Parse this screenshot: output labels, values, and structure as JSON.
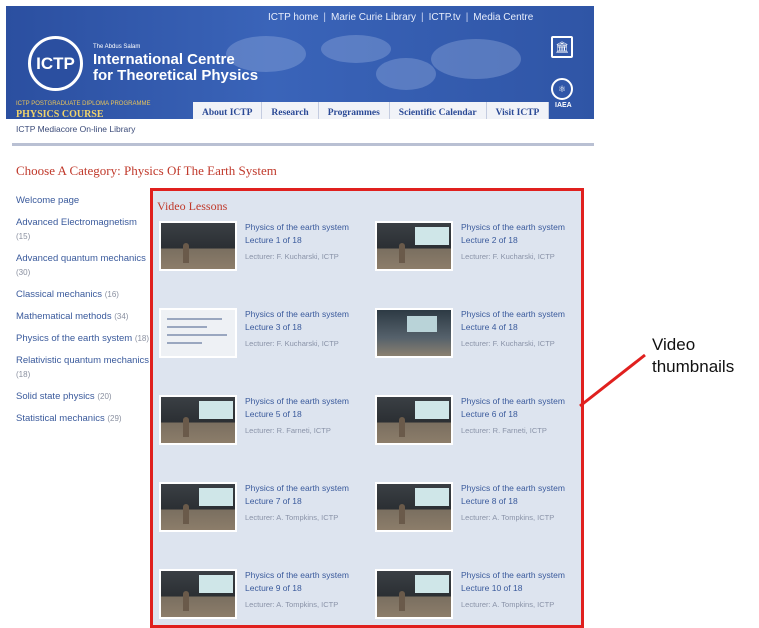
{
  "header": {
    "top_links": [
      "ICTP home",
      "Marie Curie Library",
      "ICTP.tv",
      "Media Centre"
    ],
    "logo_text": "ICTP",
    "org_small": "The Abdus Salam",
    "org_name_line1": "International Centre",
    "org_name_line2": "for Theoretical Physics",
    "course_small": "ICTP POSTGRADUATE DIPLOMA PROGRAMME",
    "course_name": "PHYSICS COURSE",
    "unesco_icon": "unesco-icon",
    "iaea_label": "IAEA"
  },
  "nav": {
    "items": [
      "About ICTP",
      "Research",
      "Programmes",
      "Scientific Calendar",
      "Visit ICTP"
    ]
  },
  "breadcrumb": "ICTP Mediacore On-line Library",
  "category_title": "Choose A Category: Physics Of The Earth System",
  "sidebar": {
    "items": [
      {
        "label": "Welcome page",
        "count": ""
      },
      {
        "label": "Advanced Electromagnetism",
        "count": "(15)"
      },
      {
        "label": "Advanced quantum mechanics",
        "count": "(30)"
      },
      {
        "label": "Classical mechanics",
        "count": "(16)"
      },
      {
        "label": "Mathematical methods",
        "count": "(34)"
      },
      {
        "label": "Physics of the earth system",
        "count": "(18)"
      },
      {
        "label": "Relativistic quantum mechanics",
        "count": "(18)"
      },
      {
        "label": "Solid state physics",
        "count": "(20)"
      },
      {
        "label": "Statistical mechanics",
        "count": "(29)"
      }
    ]
  },
  "videos": {
    "section_title": "Video Lessons",
    "items": [
      {
        "title": "Physics of the earth system",
        "lecture": "Lecture 1 of 18",
        "lecturer": "Lecturer: F. Kucharski, ICTP"
      },
      {
        "title": "Physics of the earth system",
        "lecture": "Lecture 2 of 18",
        "lecturer": "Lecturer: F. Kucharski, ICTP"
      },
      {
        "title": "Physics of the earth system",
        "lecture": "Lecture 3 of 18",
        "lecturer": "Lecturer: F. Kucharski, ICTP"
      },
      {
        "title": "Physics of the earth system",
        "lecture": "Lecture 4 of 18",
        "lecturer": "Lecturer: F. Kucharski, ICTP"
      },
      {
        "title": "Physics of the earth system",
        "lecture": "Lecture 5 of 18",
        "lecturer": "Lecturer: R. Farneti, ICTP"
      },
      {
        "title": "Physics of the earth system",
        "lecture": "Lecture 6 of 18",
        "lecturer": "Lecturer: R. Farneti, ICTP"
      },
      {
        "title": "Physics of the earth system",
        "lecture": "Lecture 7 of 18",
        "lecturer": "Lecturer: A. Tompkins, ICTP"
      },
      {
        "title": "Physics of the earth system",
        "lecture": "Lecture 8 of 18",
        "lecturer": "Lecturer: A. Tompkins, ICTP"
      },
      {
        "title": "Physics of the earth system",
        "lecture": "Lecture 9 of 18",
        "lecturer": "Lecturer: A. Tompkins, ICTP"
      },
      {
        "title": "Physics of the earth system",
        "lecture": "Lecture 10 of 18",
        "lecturer": "Lecturer: A. Tompkins, ICTP"
      }
    ]
  },
  "annotation": {
    "line1": "Video",
    "line2": "thumbnails",
    "color": "#e0201e"
  }
}
